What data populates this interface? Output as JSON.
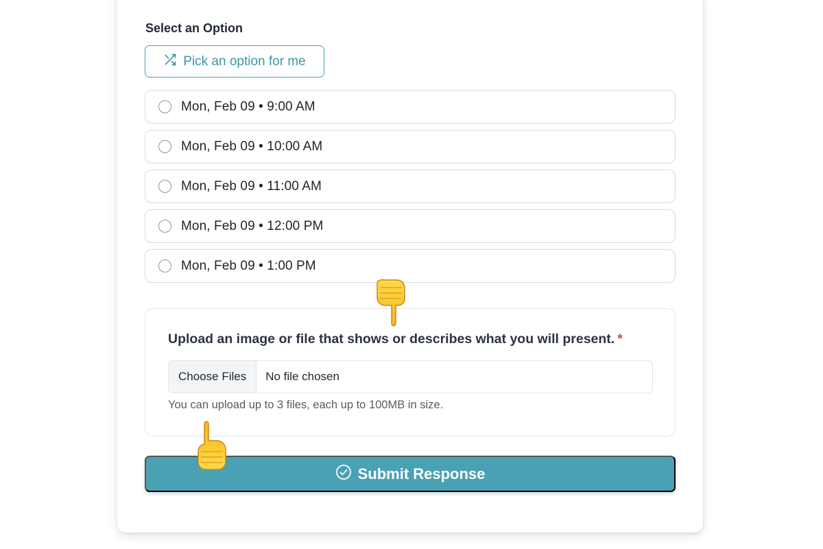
{
  "section": {
    "label": "Select an Option",
    "pick_button_label": "Pick an option for me",
    "pick_icon": "shuffle-icon"
  },
  "options": [
    {
      "label": "Mon, Feb 09 • 9:00 AM",
      "selected": false
    },
    {
      "label": "Mon, Feb 09 • 10:00 AM",
      "selected": false
    },
    {
      "label": "Mon, Feb 09 • 11:00 AM",
      "selected": false
    },
    {
      "label": "Mon, Feb 09 • 12:00 PM",
      "selected": false
    },
    {
      "label": "Mon, Feb 09 • 1:00 PM",
      "selected": false
    }
  ],
  "upload": {
    "title": "Upload an image or file that shows or describes what you will present.",
    "required_marker": "*",
    "choose_button_label": "Choose Files",
    "file_status": "No file chosen",
    "hint": "You can upload up to 3 files, each up to 100MB in size."
  },
  "submit": {
    "label": "Submit Response",
    "icon": "check-circle-icon"
  },
  "colors": {
    "accent": "#4aa1b3",
    "required": "#d64545"
  }
}
